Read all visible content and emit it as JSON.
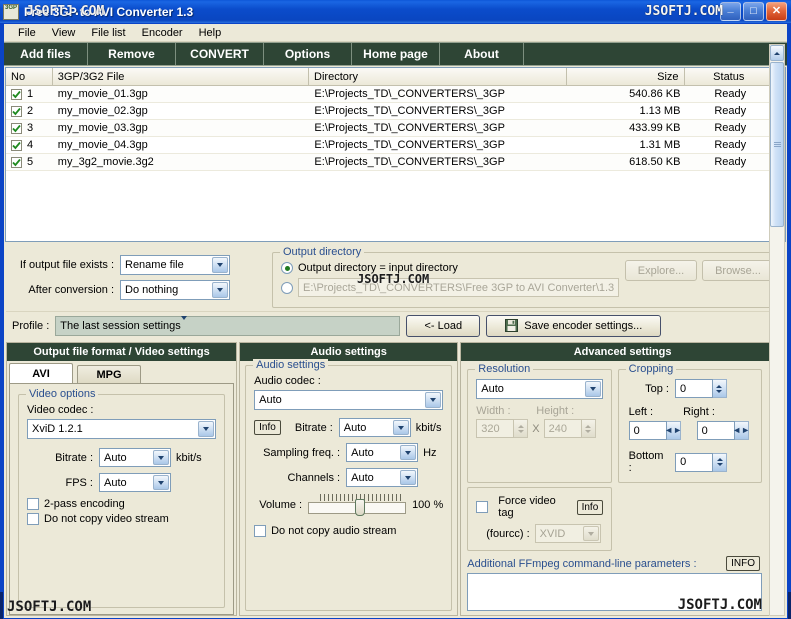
{
  "window": {
    "title": "Free 3GP to AVI Converter 1.3",
    "icon_label": "3GP",
    "controls": {
      "minimize": "_",
      "maximize": "□",
      "close": "✕"
    }
  },
  "watermarks": {
    "text": "JSOFTJ.COM",
    "title_overlay": "JSOFTJ.COM"
  },
  "menubar": {
    "items": [
      {
        "label": "File"
      },
      {
        "label": "View"
      },
      {
        "label": "File list"
      },
      {
        "label": "Encoder"
      },
      {
        "label": "Help"
      }
    ]
  },
  "toolbar": {
    "buttons": [
      {
        "label": "Add files",
        "width": 84
      },
      {
        "label": "Remove",
        "width": 88
      },
      {
        "label": "CONVERT",
        "width": 88
      },
      {
        "label": "Options",
        "width": 88
      },
      {
        "label": "Home page",
        "width": 88
      },
      {
        "label": "About",
        "width": 84
      }
    ]
  },
  "file_list": {
    "columns": [
      {
        "label": "No",
        "key": "no"
      },
      {
        "label": "3GP/3G2 File",
        "key": "file"
      },
      {
        "label": "Directory",
        "key": "dir"
      },
      {
        "label": "Size",
        "key": "size"
      },
      {
        "label": "Status",
        "key": "status"
      }
    ],
    "rows": [
      {
        "checked": true,
        "no": "1",
        "file": "my_movie_01.3gp",
        "dir": "E:\\Projects_TD\\_CONVERTERS\\_3GP",
        "size": "540.86 KB",
        "status": "Ready"
      },
      {
        "checked": true,
        "no": "2",
        "file": "my_movie_02.3gp",
        "dir": "E:\\Projects_TD\\_CONVERTERS\\_3GP",
        "size": "1.13 MB",
        "status": "Ready"
      },
      {
        "checked": true,
        "no": "3",
        "file": "my_movie_03.3gp",
        "dir": "E:\\Projects_TD\\_CONVERTERS\\_3GP",
        "size": "433.99 KB",
        "status": "Ready"
      },
      {
        "checked": true,
        "no": "4",
        "file": "my_movie_04.3gp",
        "dir": "E:\\Projects_TD\\_CONVERTERS\\_3GP",
        "size": "1.31 MB",
        "status": "Ready"
      },
      {
        "checked": true,
        "no": "5",
        "file": "my_3g2_movie.3g2",
        "dir": "E:\\Projects_TD\\_CONVERTERS\\_3GP",
        "size": "618.50 KB",
        "status": "Ready"
      }
    ]
  },
  "options": {
    "if_exists_label": "If output file exists :",
    "if_exists_value": "Rename file",
    "after_conversion_label": "After conversion :",
    "after_conversion_value": "Do nothing"
  },
  "output_directory": {
    "group_title": "Output directory",
    "radio_same_label": "Output directory = input directory",
    "radio_same_selected": true,
    "radio_custom_selected": false,
    "custom_path": "E:\\Projects_TD\\_CONVERTERS\\Free 3GP to AVI Converter\\1.3",
    "explore_label": "Explore...",
    "browse_label": "Browse..."
  },
  "profile": {
    "label": "Profile :",
    "value": "The last session settings",
    "load_label": "<- Load",
    "save_label": "Save encoder settings..."
  },
  "video_panel": {
    "title": "Output file format / Video settings",
    "tabs": [
      {
        "label": "AVI",
        "active": true
      },
      {
        "label": "MPG",
        "active": false
      }
    ],
    "group_title": "Video options",
    "codec_label": "Video codec :",
    "codec_value": "XviD 1.2.1",
    "bitrate_label": "Bitrate :",
    "bitrate_value": "Auto",
    "bitrate_unit": "kbit/s",
    "fps_label": "FPS :",
    "fps_value": "Auto",
    "two_pass_label": "2-pass encoding",
    "two_pass_checked": false,
    "no_copy_label": "Do not copy video stream",
    "no_copy_checked": false
  },
  "audio_panel": {
    "title": "Audio settings",
    "group_title": "Audio settings",
    "codec_label": "Audio codec :",
    "codec_value": "Auto",
    "info_label": "Info",
    "bitrate_label": "Bitrate :",
    "bitrate_value": "Auto",
    "bitrate_unit": "kbit/s",
    "sampling_label": "Sampling freq. :",
    "sampling_value": "Auto",
    "sampling_unit": "Hz",
    "channels_label": "Channels :",
    "channels_value": "Auto",
    "volume_label": "Volume :",
    "volume_value": "100 %",
    "no_copy_label": "Do not copy audio stream",
    "no_copy_checked": false
  },
  "advanced_panel": {
    "title": "Advanced settings",
    "resolution_group": "Resolution",
    "resolution_value": "Auto",
    "width_label": "Width :",
    "width_value": "320",
    "x_label": "X",
    "height_label": "Height :",
    "height_value": "240",
    "cropping_group": "Cropping",
    "top_label": "Top :",
    "top_value": "0",
    "left_label": "Left :",
    "left_value": "0",
    "right_label": "Right :",
    "right_value": "0",
    "bottom_label": "Bottom :",
    "bottom_value": "0",
    "force_tag_label": "Force video tag",
    "force_tag_checked": false,
    "force_tag_info": "Info",
    "fourcc_label": "(fourcc) :",
    "fourcc_value": "XVID",
    "ffmpeg_label": "Additional FFmpeg command-line parameters :",
    "ffmpeg_info": "INFO",
    "ffmpeg_value": ""
  },
  "colors": {
    "toolbar_bg": "#2e4535",
    "window_bg": "#ece9d8",
    "titlebar_blue": "#0b4ccb",
    "group_title": "#2a4f8f",
    "profile_bg": "#c6d2c6"
  }
}
